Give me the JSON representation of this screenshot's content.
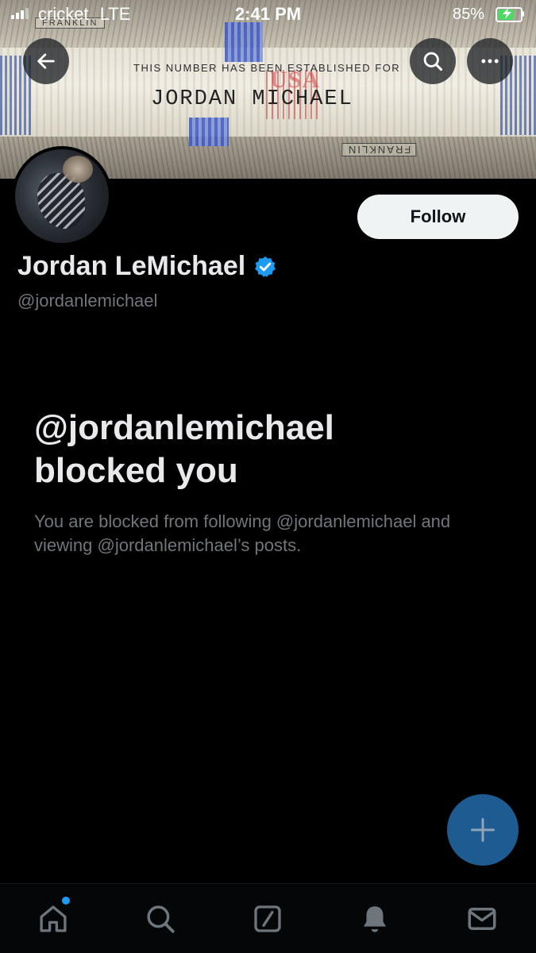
{
  "status_bar": {
    "carrier": "cricket",
    "network": "LTE",
    "time": "2:41 PM",
    "battery_percent_label": "85%",
    "battery_level": 0.85,
    "battery_charging": true
  },
  "banner": {
    "line_small": "THIS NUMBER HAS BEEN ESTABLISHED FOR",
    "line_name": "JORDAN MICHAEL",
    "mark": "USA",
    "franklin_top": "FRANKLIN",
    "franklin_bottom": "FRANKLIN"
  },
  "header": {
    "back_icon": "arrow-left-icon",
    "search_icon": "search-icon",
    "more_icon": "more-horizontal-icon"
  },
  "profile": {
    "display_name": "Jordan LeMichael",
    "verified": true,
    "handle": "@jordanlemichael",
    "follow_label": "Follow"
  },
  "blocked": {
    "title_line1": "@jordanlemichael",
    "title_line2": "blocked you",
    "description": "You are blocked from following @jordanlemichael and viewing @jordanlemichael’s posts."
  },
  "fab": {
    "icon": "plus-icon"
  },
  "bottom_nav": {
    "items": [
      {
        "icon": "home-icon",
        "has_notification_dot": true
      },
      {
        "icon": "search-icon"
      },
      {
        "icon": "grok-icon"
      },
      {
        "icon": "bell-icon"
      },
      {
        "icon": "mail-icon"
      }
    ]
  },
  "colors": {
    "background": "#000000",
    "primary_text": "#e7e9ea",
    "secondary_text": "#71767b",
    "accent_blue": "#1d9bf0",
    "fab_blue": "#1d5b91",
    "follow_button_bg": "#eff3f4"
  }
}
